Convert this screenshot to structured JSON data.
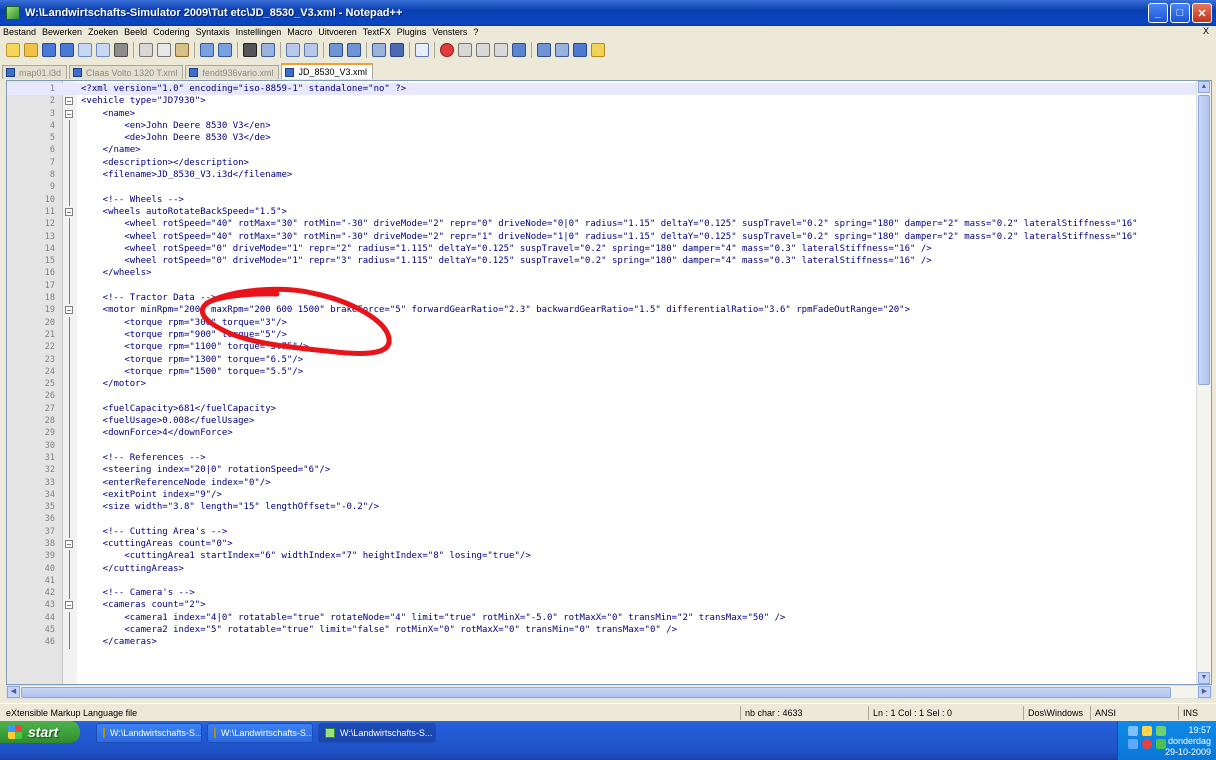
{
  "window": {
    "title": "W:\\Landwirtschafts-Simulator 2009\\Tut etc\\JD_8530_V3.xml - Notepad++"
  },
  "menu": {
    "items": [
      "Bestand",
      "Bewerken",
      "Zoeken",
      "Beeld",
      "Codering",
      "Syntaxis",
      "Instellingen",
      "Macro",
      "Uitvoeren",
      "TextFX",
      "Plugins",
      "Vensters",
      "?"
    ],
    "close": "X"
  },
  "tabs": [
    "map01.i3d",
    "Claas Volto 1320 T.xml",
    "fendt936vario.xml",
    "JD_8530_V3.xml"
  ],
  "editor": {
    "lines": [
      {
        "n": "1",
        "t": "<?xml version=\"1.0\" encoding=\"iso-8859-1\" standalone=\"no\" ?>"
      },
      {
        "n": "2",
        "t": "<vehicle type=\"JD7930\">"
      },
      {
        "n": "3",
        "t": "    <name>"
      },
      {
        "n": "4",
        "t": "        <en>John Deere 8530 V3</en>"
      },
      {
        "n": "5",
        "t": "        <de>John Deere 8530 V3</de>"
      },
      {
        "n": "6",
        "t": "    </name>"
      },
      {
        "n": "7",
        "t": "    <description></description>"
      },
      {
        "n": "8",
        "t": "    <filename>JD_8530_V3.i3d</filename>"
      },
      {
        "n": "9",
        "t": ""
      },
      {
        "n": "10",
        "t": "    <!-- Wheels -->"
      },
      {
        "n": "11",
        "t": "    <wheels autoRotateBackSpeed=\"1.5\">"
      },
      {
        "n": "12",
        "t": "        <wheel rotSpeed=\"40\" rotMax=\"30\" rotMin=\"-30\" driveMode=\"2\" repr=\"0\" driveNode=\"0|0\" radius=\"1.15\" deltaY=\"0.125\" suspTravel=\"0.2\" spring=\"180\" damper=\"2\" mass=\"0.2\" lateralStiffness=\"16\""
      },
      {
        "n": "13",
        "t": "        <wheel rotSpeed=\"40\" rotMax=\"30\" rotMin=\"-30\" driveMode=\"2\" repr=\"1\" driveNode=\"1|0\" radius=\"1.15\" deltaY=\"0.125\" suspTravel=\"0.2\" spring=\"180\" damper=\"2\" mass=\"0.2\" lateralStiffness=\"16\""
      },
      {
        "n": "14",
        "t": "        <wheel rotSpeed=\"0\" driveMode=\"1\" repr=\"2\" radius=\"1.115\" deltaY=\"0.125\" suspTravel=\"0.2\" spring=\"180\" damper=\"4\" mass=\"0.3\" lateralStiffness=\"16\" />"
      },
      {
        "n": "15",
        "t": "        <wheel rotSpeed=\"0\" driveMode=\"1\" repr=\"3\" radius=\"1.115\" deltaY=\"0.125\" suspTravel=\"0.2\" spring=\"180\" damper=\"4\" mass=\"0.3\" lateralStiffness=\"16\" />"
      },
      {
        "n": "16",
        "t": "    </wheels>"
      },
      {
        "n": "17",
        "t": ""
      },
      {
        "n": "18",
        "t": "    <!-- Tractor Data -->"
      },
      {
        "n": "19",
        "t": "    <motor minRpm=\"200\" maxRpm=\"200 600 1500\" brakeForce=\"5\" forwardGearRatio=\"2.3\" backwardGearRatio=\"1.5\" differentialRatio=\"3.6\" rpmFadeOutRange=\"20\">"
      },
      {
        "n": "20",
        "t": "        <torque rpm=\"300\" torque=\"3\"/>"
      },
      {
        "n": "21",
        "t": "        <torque rpm=\"900\" torque=\"5\"/>"
      },
      {
        "n": "22",
        "t": "        <torque rpm=\"1100\" torque=\"5.75\"/>"
      },
      {
        "n": "23",
        "t": "        <torque rpm=\"1300\" torque=\"6.5\"/>"
      },
      {
        "n": "24",
        "t": "        <torque rpm=\"1500\" torque=\"5.5\"/>"
      },
      {
        "n": "25",
        "t": "    </motor>"
      },
      {
        "n": "26",
        "t": ""
      },
      {
        "n": "27",
        "t": "    <fuelCapacity>681</fuelCapacity>"
      },
      {
        "n": "28",
        "t": "    <fuelUsage>0.008</fuelUsage>"
      },
      {
        "n": "29",
        "t": "    <downForce>4</downForce>"
      },
      {
        "n": "30",
        "t": ""
      },
      {
        "n": "31",
        "t": "    <!-- References -->"
      },
      {
        "n": "32",
        "t": "    <steering index=\"20|0\" rotationSpeed=\"6\"/>"
      },
      {
        "n": "33",
        "t": "    <enterReferenceNode index=\"0\"/>"
      },
      {
        "n": "34",
        "t": "    <exitPoint index=\"9\"/>"
      },
      {
        "n": "35",
        "t": "    <size width=\"3.8\" length=\"15\" lengthOffset=\"-0.2\"/>"
      },
      {
        "n": "36",
        "t": ""
      },
      {
        "n": "37",
        "t": "    <!-- Cutting Area's -->"
      },
      {
        "n": "38",
        "t": "    <cuttingAreas count=\"0\">"
      },
      {
        "n": "39",
        "t": "        <cuttingArea1 startIndex=\"6\" widthIndex=\"7\" heightIndex=\"8\" losing=\"true\"/>"
      },
      {
        "n": "40",
        "t": "    </cuttingAreas>"
      },
      {
        "n": "41",
        "t": ""
      },
      {
        "n": "42",
        "t": "    <!-- Camera's -->"
      },
      {
        "n": "43",
        "t": "    <cameras count=\"2\">"
      },
      {
        "n": "44",
        "t": "        <camera1 index=\"4|0\" rotatable=\"true\" rotateNode=\"4\" limit=\"true\" rotMinX=\"-5.0\" rotMaxX=\"0\" transMin=\"2\" transMax=\"50\" />"
      },
      {
        "n": "45",
        "t": "        <camera2 index=\"5\" rotatable=\"true\" limit=\"false\" rotMinX=\"0\" rotMaxX=\"0\" transMin=\"0\" transMax=\"0\" />"
      },
      {
        "n": "46",
        "t": "    </cameras>"
      }
    ]
  },
  "status": {
    "filetype": "eXtensible Markup Language file",
    "chars": "nb char : 4633",
    "position": "Ln : 1    Col : 1    Sel : 0",
    "eol": "Dos\\Windows",
    "encoding": "ANSI",
    "mode": "INS"
  },
  "taskbar": {
    "start": "start",
    "tasks": [
      "W:\\Landwirtschafts-S...",
      "W:\\Landwirtschafts-S...",
      "W:\\Landwirtschafts-S..."
    ],
    "time": "19:57",
    "day": "donderdag",
    "date": "29-10-2009"
  },
  "annotation_color": "#e8141a"
}
